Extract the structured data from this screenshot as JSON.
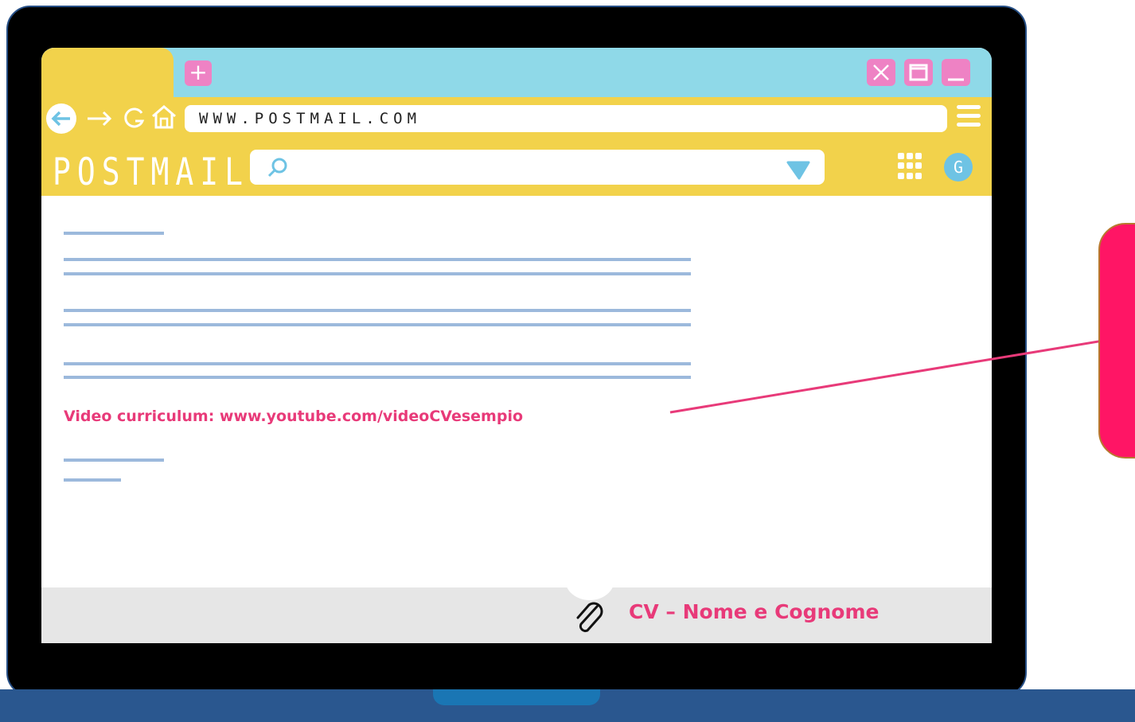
{
  "browser": {
    "new_tab_symbol": "+",
    "url": "WWW.POSTMAIL.COM",
    "app_name": "POSTMAIL",
    "avatar_initial": "G"
  },
  "email": {
    "video_link_text": "Video curriculum: www.youtube.com/videoCVesempio",
    "attachment_label": "CV – Nome e Cognome"
  },
  "colors": {
    "accent_pink": "#e83a79",
    "toolbar_yellow": "#f2d24b",
    "tabbar_cyan": "#8fd9e8",
    "button_pink": "#ee82c4",
    "laptop_blue": "#2a578f"
  },
  "icons": [
    "back-arrow-icon",
    "forward-arrow-icon",
    "reload-icon",
    "home-icon",
    "hamburger-menu-icon",
    "search-icon",
    "dropdown-triangle-icon",
    "apps-grid-icon",
    "close-icon",
    "maximize-icon",
    "minimize-icon",
    "paperclip-icon"
  ]
}
